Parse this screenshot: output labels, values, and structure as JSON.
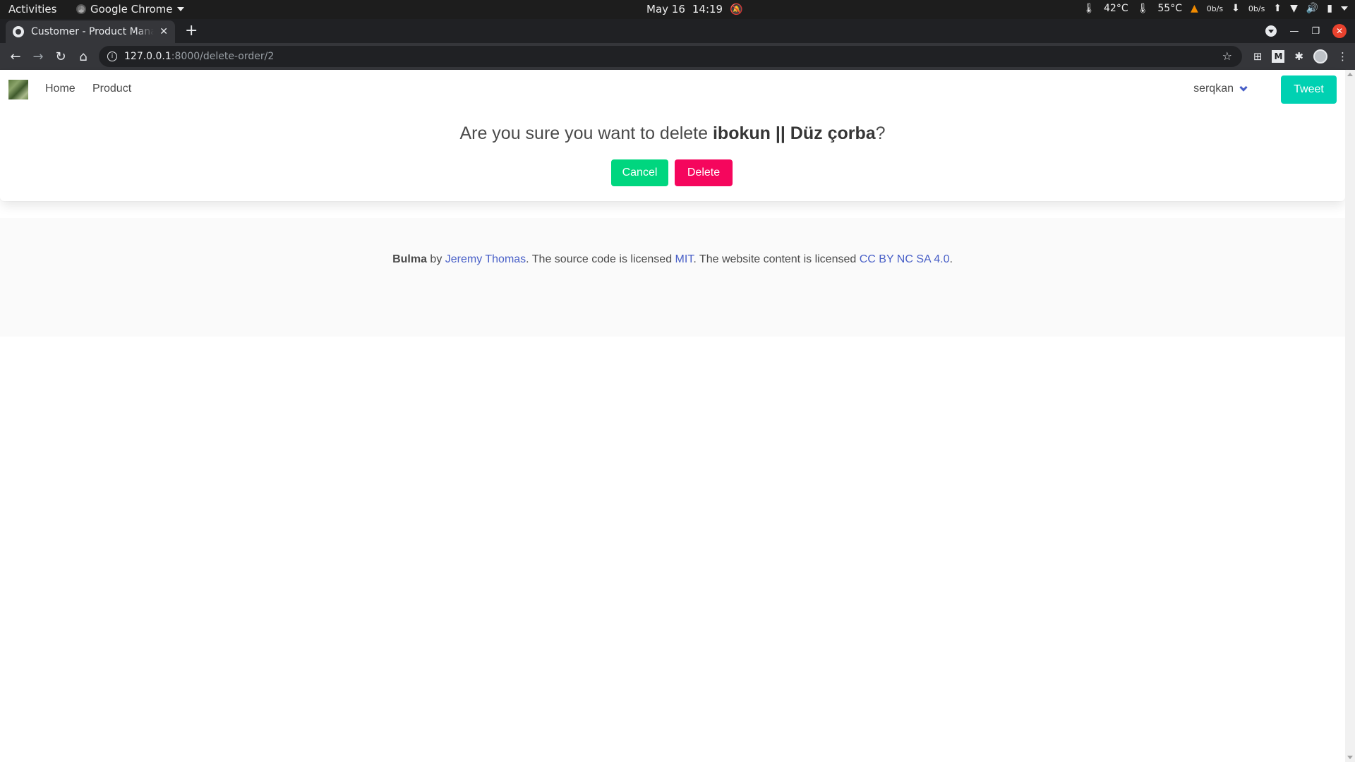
{
  "system_bar": {
    "activities": "Activities",
    "app_name": "Google Chrome",
    "date": "May 16",
    "time": "14:19",
    "temp1": "42°C",
    "temp2": "55°C",
    "net_down": "0b/s",
    "net_up": "0b/s"
  },
  "browser": {
    "tab_title": "Customer - Product Mana",
    "url_host": "127.0.0.1",
    "url_path": ":8000/delete-order/2"
  },
  "navbar": {
    "home": "Home",
    "product": "Product",
    "user": "serqkan",
    "tweet": "Tweet"
  },
  "confirm": {
    "prefix": "Are you sure you want to delete ",
    "item": "ibokun || Düz çorba",
    "suffix": "?",
    "cancel": "Cancel",
    "delete": "Delete"
  },
  "footer": {
    "brand": "Bulma",
    "by": " by ",
    "author": "Jeremy Thomas",
    "text1": ". The source code is licensed ",
    "license1": "MIT",
    "text2": ". The website content is licensed ",
    "license2": "CC BY NC SA 4.0",
    "end": "."
  },
  "colors": {
    "primary": "#00d1b2",
    "success": "#00d67f",
    "danger": "#f5065d",
    "link": "#485fc7"
  }
}
